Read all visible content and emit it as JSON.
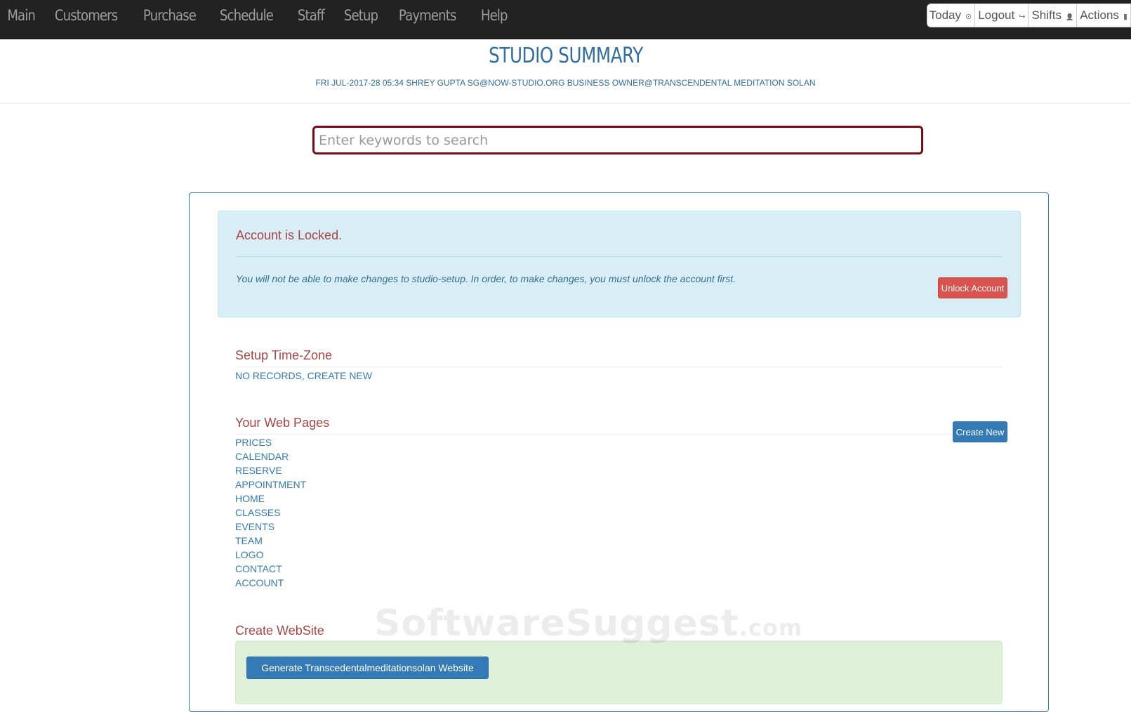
{
  "nav": {
    "items": [
      "Main",
      "Customers",
      "Purchase",
      "Schedule",
      "Staff",
      "Setup",
      "Payments",
      "Help"
    ],
    "right": [
      {
        "label": "Today",
        "icon": "clock-icon",
        "glyph": "⊙"
      },
      {
        "label": "Logout",
        "icon": "logout-icon",
        "glyph": "↪"
      },
      {
        "label": "Shifts",
        "icon": "user-icon",
        "glyph": "👤"
      },
      {
        "label": "Actions",
        "icon": "file-icon",
        "glyph": "▮"
      }
    ]
  },
  "header": {
    "title": "STUDIO SUMMARY",
    "subtitle": "FRI JUL-2017-28 05:34 SHREY GUPTA SG@NOW-STUDIO.ORG BUSINESS OWNER@TRANSCENDENTAL MEDITATION SOLAN"
  },
  "search": {
    "placeholder": "Enter keywords to search"
  },
  "alert": {
    "title": "Account is Locked.",
    "message": "You will not be able to make changes to studio-setup. In order, to make changes, you must unlock the account first.",
    "button": "Unlock Account"
  },
  "timezone": {
    "title": "Setup Time-Zone",
    "link": "NO RECORDS, CREATE NEW"
  },
  "webpages": {
    "title": "Your Web Pages",
    "button": "Create New",
    "links": [
      "PRICES",
      "CALENDAR",
      "RESERVE",
      "APPOINTMENT",
      "HOME",
      "CLASSES",
      "EVENTS",
      "TEAM",
      "LOGO",
      "CONTACT",
      "ACCOUNT"
    ]
  },
  "website": {
    "title": "Create WebSite",
    "button": "Generate Transcedentalmeditationsolan Website"
  },
  "watermark": {
    "brand": "SoftwareSuggest",
    "suffix": ".com"
  },
  "colors": {
    "primary": "#337ab7",
    "danger": "#d9534f",
    "heading": "#a94442",
    "navbar": "#222222"
  }
}
